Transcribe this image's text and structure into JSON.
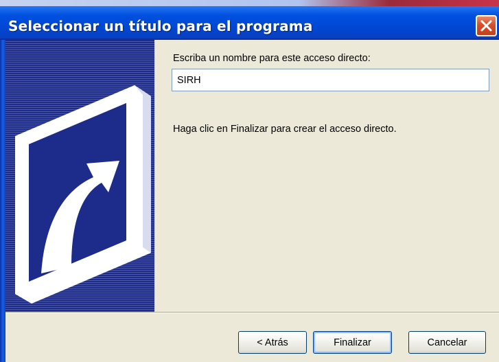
{
  "window": {
    "title": "Seleccionar un título para el programa",
    "close_icon": "close-x-icon"
  },
  "side_panel": {
    "icon": "shortcut-arrow-icon",
    "colors": {
      "background": "#1d2b8a",
      "icon": "#ffffff"
    }
  },
  "main": {
    "name_label": "Escriba un nombre para este acceso directo:",
    "name_value": "SIRH",
    "info_text": "Haga clic en Finalizar para crear el acceso directo."
  },
  "buttons": {
    "back_label": "< Atrás",
    "finish_label": "Finalizar",
    "cancel_label": "Cancelar"
  },
  "colors": {
    "titlebar": "#0050e0",
    "dialog_background": "#ece9d8",
    "close_button": "#d5502b"
  }
}
